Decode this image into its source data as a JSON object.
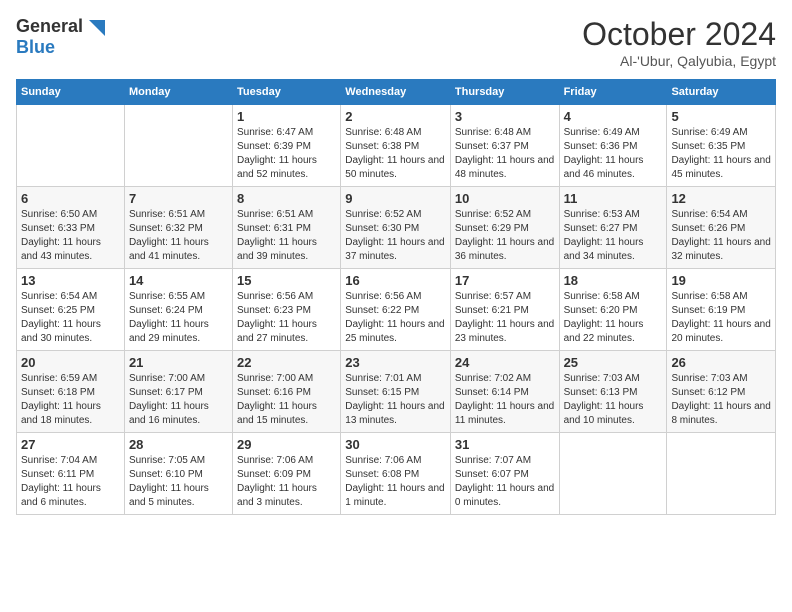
{
  "logo": {
    "general": "General",
    "blue": "Blue"
  },
  "title": "October 2024",
  "location": "Al-'Ubur, Qalyubia, Egypt",
  "days_of_week": [
    "Sunday",
    "Monday",
    "Tuesday",
    "Wednesday",
    "Thursday",
    "Friday",
    "Saturday"
  ],
  "weeks": [
    [
      {
        "day": "",
        "info": ""
      },
      {
        "day": "",
        "info": ""
      },
      {
        "day": "1",
        "info": "Sunrise: 6:47 AM\nSunset: 6:39 PM\nDaylight: 11 hours and 52 minutes."
      },
      {
        "day": "2",
        "info": "Sunrise: 6:48 AM\nSunset: 6:38 PM\nDaylight: 11 hours and 50 minutes."
      },
      {
        "day": "3",
        "info": "Sunrise: 6:48 AM\nSunset: 6:37 PM\nDaylight: 11 hours and 48 minutes."
      },
      {
        "day": "4",
        "info": "Sunrise: 6:49 AM\nSunset: 6:36 PM\nDaylight: 11 hours and 46 minutes."
      },
      {
        "day": "5",
        "info": "Sunrise: 6:49 AM\nSunset: 6:35 PM\nDaylight: 11 hours and 45 minutes."
      }
    ],
    [
      {
        "day": "6",
        "info": "Sunrise: 6:50 AM\nSunset: 6:33 PM\nDaylight: 11 hours and 43 minutes."
      },
      {
        "day": "7",
        "info": "Sunrise: 6:51 AM\nSunset: 6:32 PM\nDaylight: 11 hours and 41 minutes."
      },
      {
        "day": "8",
        "info": "Sunrise: 6:51 AM\nSunset: 6:31 PM\nDaylight: 11 hours and 39 minutes."
      },
      {
        "day": "9",
        "info": "Sunrise: 6:52 AM\nSunset: 6:30 PM\nDaylight: 11 hours and 37 minutes."
      },
      {
        "day": "10",
        "info": "Sunrise: 6:52 AM\nSunset: 6:29 PM\nDaylight: 11 hours and 36 minutes."
      },
      {
        "day": "11",
        "info": "Sunrise: 6:53 AM\nSunset: 6:27 PM\nDaylight: 11 hours and 34 minutes."
      },
      {
        "day": "12",
        "info": "Sunrise: 6:54 AM\nSunset: 6:26 PM\nDaylight: 11 hours and 32 minutes."
      }
    ],
    [
      {
        "day": "13",
        "info": "Sunrise: 6:54 AM\nSunset: 6:25 PM\nDaylight: 11 hours and 30 minutes."
      },
      {
        "day": "14",
        "info": "Sunrise: 6:55 AM\nSunset: 6:24 PM\nDaylight: 11 hours and 29 minutes."
      },
      {
        "day": "15",
        "info": "Sunrise: 6:56 AM\nSunset: 6:23 PM\nDaylight: 11 hours and 27 minutes."
      },
      {
        "day": "16",
        "info": "Sunrise: 6:56 AM\nSunset: 6:22 PM\nDaylight: 11 hours and 25 minutes."
      },
      {
        "day": "17",
        "info": "Sunrise: 6:57 AM\nSunset: 6:21 PM\nDaylight: 11 hours and 23 minutes."
      },
      {
        "day": "18",
        "info": "Sunrise: 6:58 AM\nSunset: 6:20 PM\nDaylight: 11 hours and 22 minutes."
      },
      {
        "day": "19",
        "info": "Sunrise: 6:58 AM\nSunset: 6:19 PM\nDaylight: 11 hours and 20 minutes."
      }
    ],
    [
      {
        "day": "20",
        "info": "Sunrise: 6:59 AM\nSunset: 6:18 PM\nDaylight: 11 hours and 18 minutes."
      },
      {
        "day": "21",
        "info": "Sunrise: 7:00 AM\nSunset: 6:17 PM\nDaylight: 11 hours and 16 minutes."
      },
      {
        "day": "22",
        "info": "Sunrise: 7:00 AM\nSunset: 6:16 PM\nDaylight: 11 hours and 15 minutes."
      },
      {
        "day": "23",
        "info": "Sunrise: 7:01 AM\nSunset: 6:15 PM\nDaylight: 11 hours and 13 minutes."
      },
      {
        "day": "24",
        "info": "Sunrise: 7:02 AM\nSunset: 6:14 PM\nDaylight: 11 hours and 11 minutes."
      },
      {
        "day": "25",
        "info": "Sunrise: 7:03 AM\nSunset: 6:13 PM\nDaylight: 11 hours and 10 minutes."
      },
      {
        "day": "26",
        "info": "Sunrise: 7:03 AM\nSunset: 6:12 PM\nDaylight: 11 hours and 8 minutes."
      }
    ],
    [
      {
        "day": "27",
        "info": "Sunrise: 7:04 AM\nSunset: 6:11 PM\nDaylight: 11 hours and 6 minutes."
      },
      {
        "day": "28",
        "info": "Sunrise: 7:05 AM\nSunset: 6:10 PM\nDaylight: 11 hours and 5 minutes."
      },
      {
        "day": "29",
        "info": "Sunrise: 7:06 AM\nSunset: 6:09 PM\nDaylight: 11 hours and 3 minutes."
      },
      {
        "day": "30",
        "info": "Sunrise: 7:06 AM\nSunset: 6:08 PM\nDaylight: 11 hours and 1 minute."
      },
      {
        "day": "31",
        "info": "Sunrise: 7:07 AM\nSunset: 6:07 PM\nDaylight: 11 hours and 0 minutes."
      },
      {
        "day": "",
        "info": ""
      },
      {
        "day": "",
        "info": ""
      }
    ]
  ]
}
